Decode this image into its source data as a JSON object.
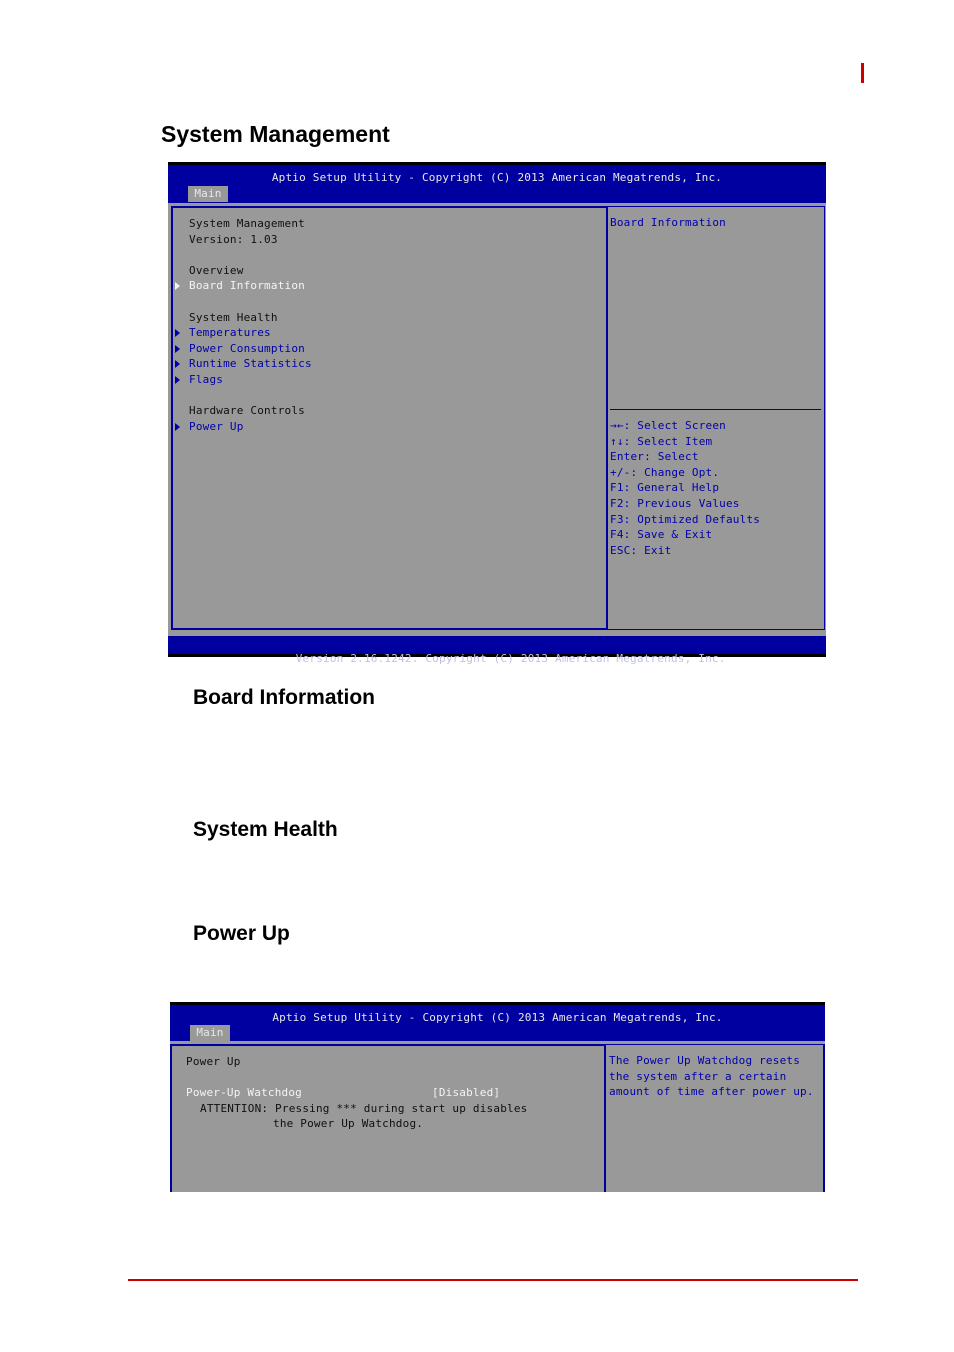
{
  "page": {
    "heading": "System Management",
    "sections": [
      {
        "heading": "Board Information"
      },
      {
        "heading": "System Health"
      },
      {
        "heading": "Power Up"
      }
    ]
  },
  "colors": {
    "bios_blue": "#0000a0",
    "bios_gray": "#999999",
    "accent_red": "#cc0000"
  },
  "screen1": {
    "title": "Aptio Setup Utility - Copyright (C) 2013 American Megatrends, Inc.",
    "tab": "Main",
    "left": {
      "header_lines": [
        "System Management",
        "Version: 1.03"
      ],
      "groups": [
        {
          "label": "Overview",
          "items": [
            {
              "label": "Board Information",
              "selected": true
            }
          ]
        },
        {
          "label": "System Health",
          "items": [
            {
              "label": "Temperatures",
              "selected": false
            },
            {
              "label": "Power Consumption",
              "selected": false
            },
            {
              "label": "Runtime Statistics",
              "selected": false
            },
            {
              "label": "Flags",
              "selected": false
            }
          ]
        },
        {
          "label": "Hardware Controls",
          "items": [
            {
              "label": "Power Up",
              "selected": false
            }
          ]
        }
      ]
    },
    "help": "Board Information",
    "keys": [
      "→←: Select Screen",
      "↑↓: Select Item",
      "Enter: Select",
      "+/-: Change Opt.",
      "F1: General Help",
      "F2: Previous Values",
      "F3: Optimized Defaults",
      "F4: Save & Exit",
      "ESC: Exit"
    ],
    "footer": "Version 2.16.1242. Copyright (C) 2013 American Megatrends, Inc."
  },
  "screen2": {
    "title": "Aptio Setup Utility - Copyright (C) 2013 American Megatrends, Inc.",
    "tab": "Main",
    "left": {
      "header": "Power Up",
      "setting_label": "Power-Up Watchdog",
      "setting_value": "[Disabled]",
      "note_line1": "ATTENTION: Pressing *** during start up disables",
      "note_line2": "the Power Up Watchdog."
    },
    "help_lines": [
      "The Power Up Watchdog resets",
      "the system after a certain",
      "amount of time after power up."
    ]
  }
}
